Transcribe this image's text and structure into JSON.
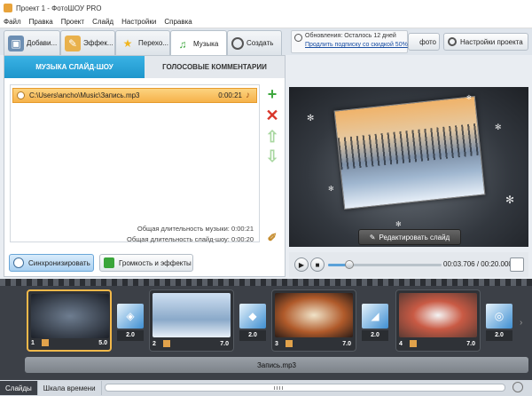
{
  "window": {
    "title": "Проект 1 - ФотоШОУ PRO"
  },
  "menu": [
    "Файл",
    "Правка",
    "Проект",
    "Слайд",
    "Настройки",
    "Справка"
  ],
  "toolbar": {
    "tabs": [
      {
        "label": "Добави...",
        "icon": "add-photos-icon"
      },
      {
        "label": "Эффек...",
        "icon": "effects-icon"
      },
      {
        "label": "Перехо...",
        "icon": "transitions-icon"
      },
      {
        "label": "Музыка",
        "icon": "music-icon"
      },
      {
        "label": "Создать",
        "icon": "create-icon"
      }
    ],
    "active_tab": "Музыка",
    "update_line1": "Обновления: Осталось 12 дней",
    "update_line2": "Продлить подписку со скидкой 50%",
    "photo_button": "фото",
    "settings_button": "Настройки проекта"
  },
  "music_panel": {
    "subtabs": [
      "МУЗЫКА СЛАЙД-ШОУ",
      "ГОЛОСОВЫЕ КОММЕНТАРИИ"
    ],
    "tracks": [
      {
        "path": "C:\\Users\\ancho\\Music\\Запись.mp3",
        "duration": "0:00:21"
      }
    ],
    "music_duration": "Общая длительность музыки: 0:00:21",
    "slideshow_duration": "Общая длительность слайд-шоу: 0:00:20",
    "sync_button": "Синхронизировать",
    "volume_button": "Громкость и эффекты"
  },
  "preview": {
    "edit_button": "Редактировать слайд",
    "time": "00:03.706 / 00:20.000",
    "progress": 0.185
  },
  "timeline": {
    "slides": [
      {
        "num": "1",
        "duration": "5.0"
      },
      {
        "num": "2",
        "duration": "7.0"
      },
      {
        "num": "3",
        "duration": "7.0"
      },
      {
        "num": "4",
        "duration": "7.0"
      }
    ],
    "transitions": [
      "2.0",
      "2.0",
      "2.0",
      "2.0"
    ],
    "audio_track": "Запись.mp3"
  },
  "bottom": {
    "tabs": [
      "Слайды",
      "Шкала времени"
    ]
  },
  "colors": {
    "accent": "#1e96cc",
    "track_highlight": "#f6b24a",
    "selection": "#f2b84a"
  }
}
